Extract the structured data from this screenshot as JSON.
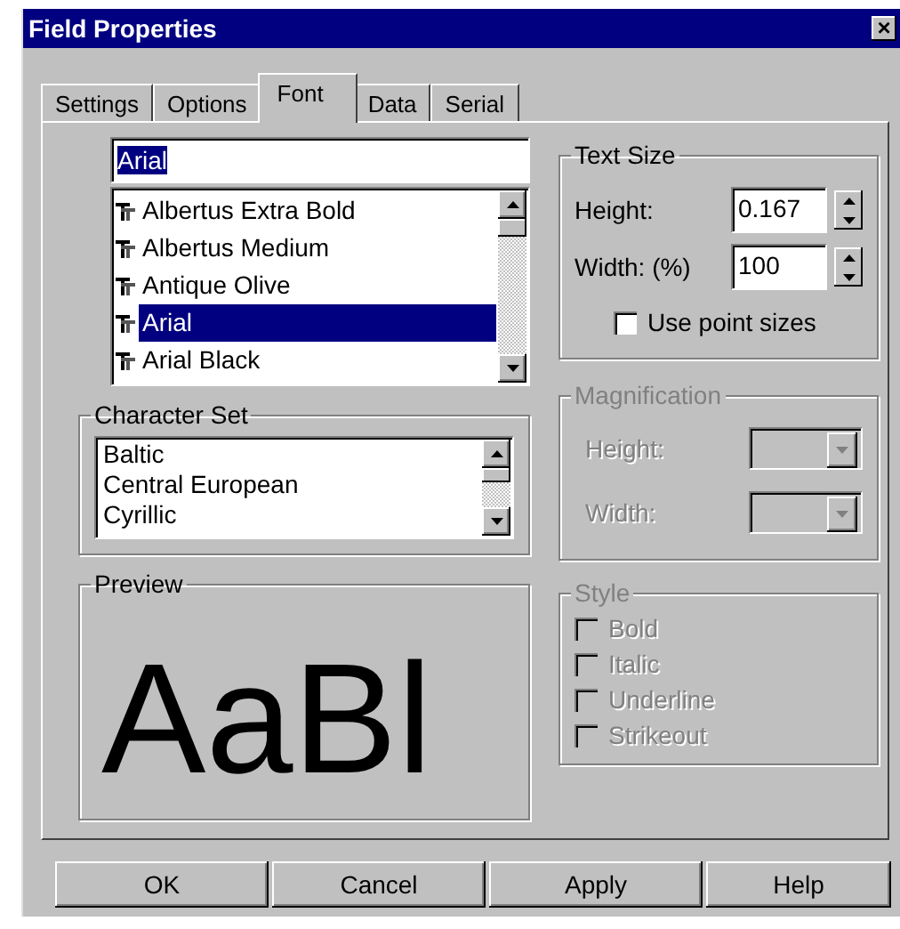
{
  "window": {
    "title": "Field Properties",
    "close": "×"
  },
  "tabs": [
    {
      "label": "Settings",
      "selected": false
    },
    {
      "label": "Options",
      "selected": false
    },
    {
      "label": "Font",
      "selected": true
    },
    {
      "label": "Data",
      "selected": false
    },
    {
      "label": "Serial",
      "selected": false
    }
  ],
  "font": {
    "value": "Arial",
    "items": [
      {
        "label": "Albertus Extra Bold",
        "selected": false
      },
      {
        "label": "Albertus Medium",
        "selected": false
      },
      {
        "label": "Antique Olive",
        "selected": false
      },
      {
        "label": "Arial",
        "selected": true
      },
      {
        "label": "Arial Black",
        "selected": false
      }
    ]
  },
  "text_size": {
    "title": "Text Size",
    "height_label": "Height:",
    "height_value": "0.167",
    "width_label": "Width: (%)",
    "width_value": "100",
    "point_sizes": {
      "label": "Use point sizes",
      "checked": false
    }
  },
  "character_set": {
    "title": "Character Set",
    "items": [
      "Baltic",
      "Central European",
      "Cyrillic"
    ]
  },
  "preview": {
    "title": "Preview",
    "sample": "AaBl"
  },
  "magnification": {
    "title": "Magnification",
    "disabled": true,
    "height_label": "Height:",
    "width_label": "Width:"
  },
  "style": {
    "title": "Style",
    "disabled": true,
    "options": [
      {
        "label": "Bold",
        "checked": false
      },
      {
        "label": "Italic",
        "checked": false
      },
      {
        "label": "Underline",
        "checked": false
      },
      {
        "label": "Strikeout",
        "checked": false
      }
    ]
  },
  "buttons": [
    "OK",
    "Cancel",
    "Apply",
    "Help"
  ]
}
